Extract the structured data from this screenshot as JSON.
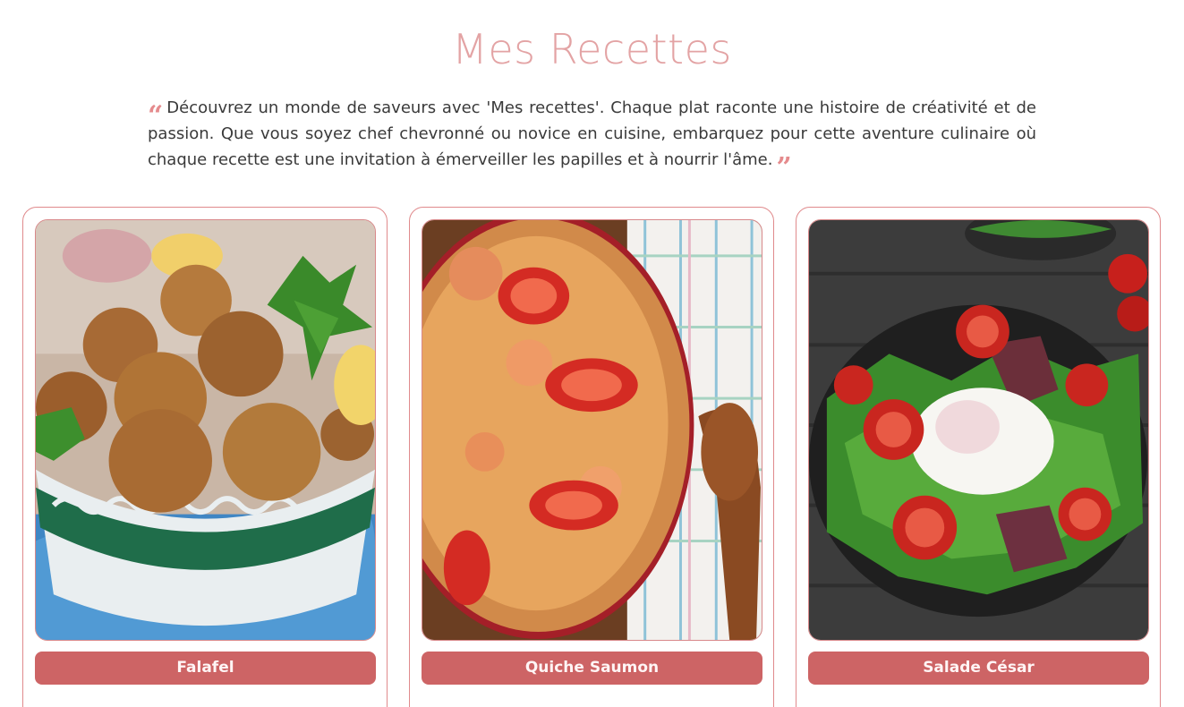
{
  "header": {
    "title": "Mes Recettes",
    "intro": "Découvrez un monde de saveurs avec 'Mes recettes'. Chaque plat raconte une histoire de créativité et de passion. Que vous soyez chef chevronné ou novice en cuisine, embarquez pour cette aventure culinaire où chaque recette est une invitation à émerveiller les papilles et à nourrir l'âme."
  },
  "recipes": [
    {
      "name": "Falafel",
      "image": "falafel-photo"
    },
    {
      "name": "Quiche Saumon",
      "image": "quiche-saumon-photo"
    },
    {
      "name": "Salade César",
      "image": "salade-cesar-photo"
    }
  ],
  "colors": {
    "title": "#e3a3a4",
    "accent": "#cd6465",
    "card_border": "#e08a8c",
    "quote_marks": "#e58b8d"
  },
  "icons": {
    "quote_open": "quote-open-icon",
    "quote_close": "quote-close-icon"
  }
}
